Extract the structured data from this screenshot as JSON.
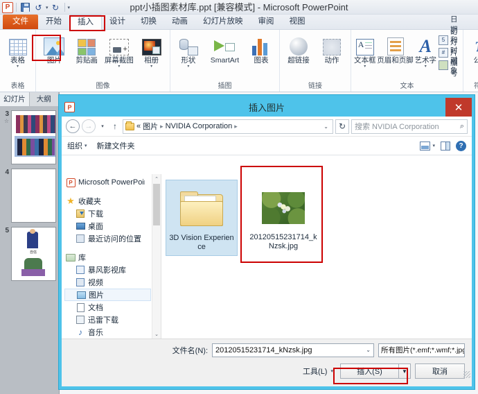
{
  "app": {
    "title": "ppt小插图素材库.ppt [兼容模式] - Microsoft PowerPoint",
    "logo": "P",
    "quick_access": [
      {
        "name": "save-icon",
        "label": "保存"
      },
      {
        "name": "undo-icon",
        "label": "撤销"
      },
      {
        "name": "redo-icon",
        "label": "重复"
      },
      {
        "name": "customize-qat-icon",
        "label": "自定义快速访问工具栏"
      }
    ]
  },
  "ribbon": {
    "tabs": [
      {
        "label": "文件",
        "type": "file"
      },
      {
        "label": "开始",
        "type": "normal"
      },
      {
        "label": "插入",
        "type": "active"
      },
      {
        "label": "设计",
        "type": "normal"
      },
      {
        "label": "切换",
        "type": "normal"
      },
      {
        "label": "动画",
        "type": "normal"
      },
      {
        "label": "幻灯片放映",
        "type": "normal"
      },
      {
        "label": "审阅",
        "type": "normal"
      },
      {
        "label": "视图",
        "type": "normal"
      }
    ],
    "groups": [
      {
        "label": "表格",
        "buttons": [
          {
            "label": "表格",
            "icon": "table-icon",
            "dropdown": true
          }
        ]
      },
      {
        "label": "图像",
        "buttons": [
          {
            "label": "图片",
            "icon": "picture-icon",
            "dropdown": false,
            "highlighted": true
          },
          {
            "label": "剪贴画",
            "icon": "clipart-icon",
            "dropdown": false
          },
          {
            "label": "屏幕截图",
            "icon": "screenshot-icon",
            "dropdown": true
          },
          {
            "label": "相册",
            "icon": "photo-album-icon",
            "dropdown": true
          }
        ]
      },
      {
        "label": "插图",
        "buttons": [
          {
            "label": "形状",
            "icon": "shapes-icon",
            "dropdown": true
          },
          {
            "label": "SmartArt",
            "icon": "smartart-icon",
            "dropdown": false
          },
          {
            "label": "图表",
            "icon": "chart-icon",
            "dropdown": false
          }
        ]
      },
      {
        "label": "链接",
        "buttons": [
          {
            "label": "超链接",
            "icon": "hyperlink-icon",
            "dropdown": false
          },
          {
            "label": "动作",
            "icon": "action-icon",
            "dropdown": false
          }
        ]
      },
      {
        "label": "文本",
        "buttons": [
          {
            "label": "文本框",
            "icon": "textbox-icon",
            "dropdown": true
          },
          {
            "label": "页眉和页脚",
            "icon": "header-footer-icon",
            "dropdown": false
          },
          {
            "label": "艺术字",
            "icon": "wordart-icon",
            "dropdown": true
          }
        ],
        "small_buttons": [
          {
            "label": "日期和时间",
            "icon": "date-time-icon"
          },
          {
            "label": "幻灯片编号",
            "icon": "slide-number-icon"
          },
          {
            "label": "对象",
            "icon": "object-icon"
          }
        ]
      },
      {
        "label": "符号",
        "buttons": [
          {
            "label": "公式",
            "icon": "equation-icon",
            "dropdown": true
          }
        ]
      }
    ]
  },
  "slides_pane": {
    "tabs": [
      {
        "label": "幻灯片",
        "active": true
      },
      {
        "label": "大纲",
        "active": false
      }
    ],
    "slides": [
      {
        "number": "3",
        "starred": true
      },
      {
        "number": "4",
        "starred": false
      },
      {
        "number": "5",
        "starred": false
      }
    ]
  },
  "dialog": {
    "title": "插入图片",
    "icon": "powerpoint-icon",
    "close_label": "✕",
    "nav": {
      "back_label": "←",
      "forward_label": "→",
      "history_label": "▾",
      "up_label": "↑",
      "breadcrumb": [
        "«",
        "图片",
        "NVIDIA Corporation",
        ""
      ],
      "breadcrumb_caret": "⌄",
      "refresh_label": "↻",
      "search_placeholder": "搜索 NVIDIA Corporation",
      "search_icon": "search-icon"
    },
    "toolbar": {
      "organize_label": "组织",
      "organize_caret": "▾",
      "new_folder_label": "新建文件夹",
      "view_icon": "view-layout-icon",
      "view_caret": "▾",
      "preview_icon": "preview-pane-icon",
      "help_icon": "help-icon",
      "help_glyph": "?"
    },
    "sidebar": {
      "items": [
        {
          "label": "Microsoft PowerPoint",
          "icon": "powerpoint-icon",
          "level": 0,
          "type": "root"
        },
        {
          "label": "收藏夹",
          "icon": "favorites-star-icon",
          "level": 0,
          "type": "header"
        },
        {
          "label": "下载",
          "icon": "downloads-icon",
          "level": 1,
          "type": "item"
        },
        {
          "label": "桌面",
          "icon": "desktop-icon",
          "level": 1,
          "type": "item"
        },
        {
          "label": "最近访问的位置",
          "icon": "recent-places-icon",
          "level": 1,
          "type": "item"
        },
        {
          "label": "库",
          "icon": "library-icon",
          "level": 0,
          "type": "header"
        },
        {
          "label": "暴风影视库",
          "icon": "video-library-icon",
          "level": 1,
          "type": "item"
        },
        {
          "label": "视频",
          "icon": "videos-icon",
          "level": 1,
          "type": "item"
        },
        {
          "label": "图片",
          "icon": "pictures-icon",
          "level": 1,
          "type": "item",
          "selected": true
        },
        {
          "label": "文档",
          "icon": "documents-icon",
          "level": 1,
          "type": "item"
        },
        {
          "label": "迅雷下载",
          "icon": "thunder-download-icon",
          "level": 1,
          "type": "item"
        },
        {
          "label": "音乐",
          "icon": "music-icon",
          "level": 1,
          "type": "item"
        }
      ],
      "scroll_up": "⌃",
      "scroll_down": "⌄"
    },
    "files": [
      {
        "name": "3D Vision Experience",
        "kind": "folder",
        "selected": true,
        "highlighted": false
      },
      {
        "name": "20120515231714_kNzsk.jpg",
        "kind": "image",
        "selected": false,
        "highlighted": true
      }
    ],
    "footer": {
      "filename_label": "文件名(N):",
      "filename_value": "20120515231714_kNzsk.jpg",
      "filename_caret": "⌄",
      "filter_value": "所有图片(*.emf;*.wmf;*.jpg;*.jp",
      "filter_caret": "⌄",
      "tools_label": "工具(L)",
      "tools_caret": "▾",
      "insert_label": "插入(S)",
      "insert_caret": "▼",
      "cancel_label": "取消"
    }
  },
  "colors": {
    "accent_orange": "#d0490f",
    "dialog_border": "#4ec3ea",
    "highlight_red": "#cc0000",
    "close_red": "#c0392b",
    "selection_blue": "#cfe4f2"
  }
}
